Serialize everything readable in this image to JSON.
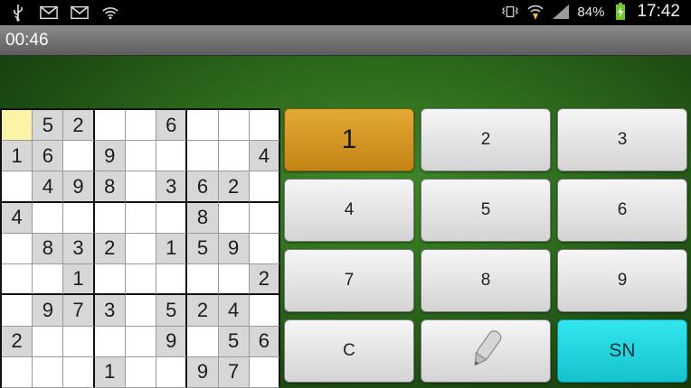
{
  "status_bar": {
    "battery_percent": "84%",
    "time": "17:42",
    "icons_left": [
      "usb-icon",
      "gmail-icon",
      "gmail-icon",
      "wifi-icon"
    ],
    "icons_right": [
      "vibrate-icon",
      "wifi-signal-icon",
      "cell-signal-icon",
      "battery-charging-icon"
    ]
  },
  "timer": {
    "value": "00:46"
  },
  "grid": {
    "rows": [
      [
        "",
        "5",
        "2",
        "",
        "",
        "6",
        "",
        "",
        ""
      ],
      [
        "1",
        "6",
        "",
        "9",
        "",
        "",
        "",
        "",
        "4"
      ],
      [
        "",
        "4",
        "9",
        "8",
        "",
        "3",
        "6",
        "2",
        ""
      ],
      [
        "4",
        "",
        "",
        "",
        "",
        "",
        "8",
        "",
        ""
      ],
      [
        "",
        "8",
        "3",
        "2",
        "",
        "1",
        "5",
        "9",
        ""
      ],
      [
        "",
        "",
        "1",
        "",
        "",
        "",
        "",
        "",
        "2"
      ],
      [
        "",
        "9",
        "7",
        "3",
        "",
        "5",
        "2",
        "4",
        ""
      ],
      [
        "2",
        "",
        "",
        "",
        "",
        "9",
        "",
        "5",
        "6"
      ],
      [
        "",
        "",
        "",
        "1",
        "",
        "",
        "9",
        "7",
        ""
      ]
    ],
    "selected": [
      0,
      0
    ]
  },
  "keypad": {
    "keys": [
      "1",
      "2",
      "3",
      "4",
      "5",
      "6",
      "7",
      "8",
      "9",
      "C",
      "",
      "SN"
    ],
    "active": "1",
    "pencil_icon": "pencil-icon",
    "colors": {
      "active": "#d49b26",
      "sn": "#1fd6e0",
      "default": "#e6e6e6"
    }
  }
}
